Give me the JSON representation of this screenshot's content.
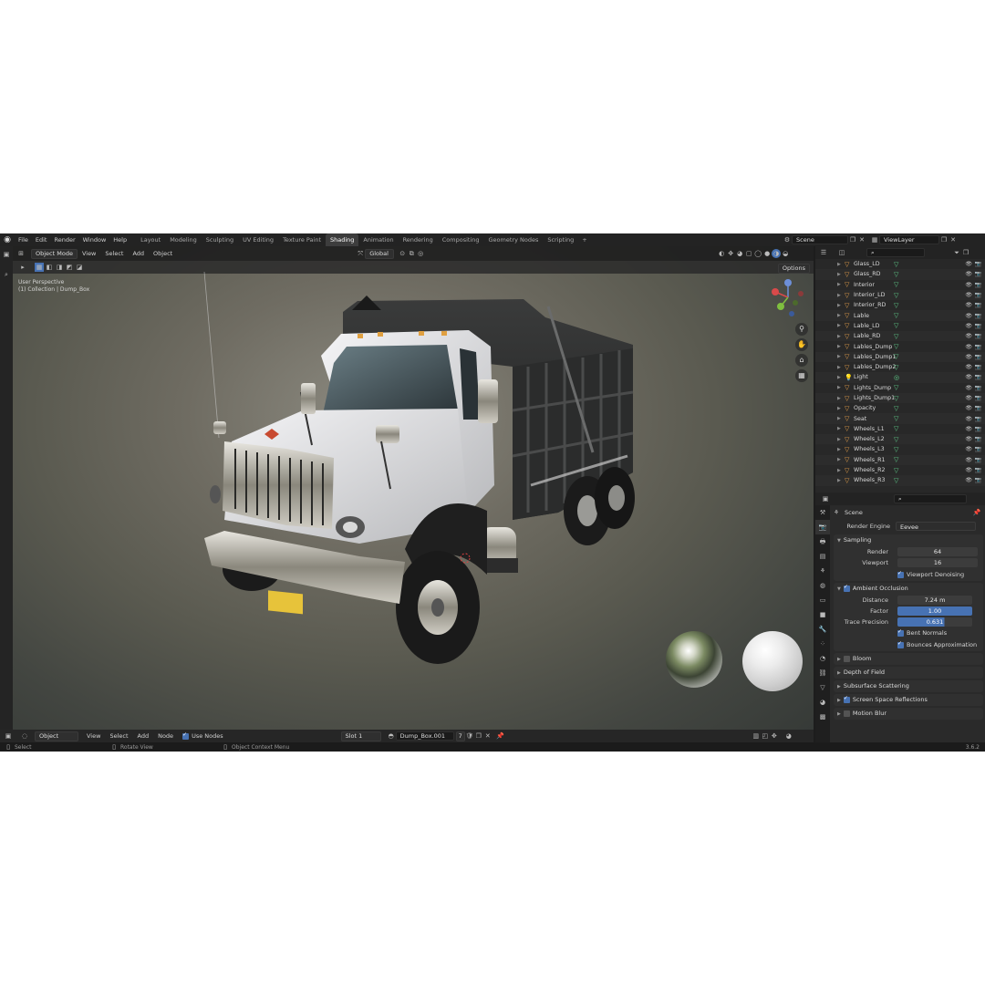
{
  "topbar": {
    "menu": [
      "File",
      "Edit",
      "Render",
      "Window",
      "Help"
    ],
    "workspaces": [
      "Layout",
      "Modeling",
      "Sculpting",
      "UV Editing",
      "Texture Paint",
      "Shading",
      "Animation",
      "Rendering",
      "Compositing",
      "Geometry Nodes",
      "Scripting"
    ],
    "active_workspace": "Shading",
    "add_tab": "+",
    "scene": "Scene",
    "view_layer": "ViewLayer"
  },
  "viewport": {
    "mode": "Object Mode",
    "menu": [
      "View",
      "Select",
      "Add",
      "Object"
    ],
    "orientation": "Global",
    "options": "Options",
    "info_line1": "User Perspective",
    "info_line2": "(1) Collection | Dump_Box"
  },
  "node_editor": {
    "type": "Object",
    "menu": [
      "View",
      "Select",
      "Add",
      "Node"
    ],
    "use_nodes_label": "Use Nodes",
    "slot": "Slot 1",
    "material": "Dump_Box.001",
    "users": "7"
  },
  "outliner": {
    "items": [
      {
        "name": "Glass_LD",
        "type": "mesh"
      },
      {
        "name": "Glass_RD",
        "type": "mesh"
      },
      {
        "name": "Interior",
        "type": "mesh"
      },
      {
        "name": "Interior_LD",
        "type": "mesh"
      },
      {
        "name": "Interior_RD",
        "type": "mesh"
      },
      {
        "name": "Lable",
        "type": "mesh"
      },
      {
        "name": "Lable_LD",
        "type": "mesh"
      },
      {
        "name": "Lable_RD",
        "type": "mesh"
      },
      {
        "name": "Lables_Dump",
        "type": "mesh"
      },
      {
        "name": "Lables_Dump1",
        "type": "mesh"
      },
      {
        "name": "Lables_Dump2",
        "type": "mesh"
      },
      {
        "name": "Light",
        "type": "light"
      },
      {
        "name": "Lights_Dump",
        "type": "mesh"
      },
      {
        "name": "Lights_Dump1",
        "type": "mesh"
      },
      {
        "name": "Opacity",
        "type": "mesh"
      },
      {
        "name": "Seat",
        "type": "mesh"
      },
      {
        "name": "Wheels_L1",
        "type": "mesh"
      },
      {
        "name": "Wheels_L2",
        "type": "mesh"
      },
      {
        "name": "Wheels_L3",
        "type": "mesh"
      },
      {
        "name": "Wheels_R1",
        "type": "mesh"
      },
      {
        "name": "Wheels_R2",
        "type": "mesh"
      },
      {
        "name": "Wheels_R3",
        "type": "mesh"
      }
    ]
  },
  "properties": {
    "context": "Scene",
    "render_engine_label": "Render Engine",
    "render_engine": "Eevee",
    "sampling": {
      "title": "Sampling",
      "render_label": "Render",
      "render": "64",
      "viewport_label": "Viewport",
      "viewport": "16",
      "denoise_label": "Viewport Denoising"
    },
    "ao": {
      "title": "Ambient Occlusion",
      "distance_label": "Distance",
      "distance": "7.24 m",
      "factor_label": "Factor",
      "factor": "1.00",
      "trace_label": "Trace Precision",
      "trace": "0.631",
      "bent_label": "Bent Normals",
      "bounces_label": "Bounces Approximation"
    },
    "panels": [
      "Bloom",
      "Depth of Field",
      "Subsurface Scattering",
      "Screen Space Reflections",
      "Motion Blur"
    ]
  },
  "statusbar": {
    "select": "Select",
    "rotate": "Rotate View",
    "context": "Object Context Menu",
    "version": "3.6.2"
  },
  "colors": {
    "accent": "#4772b3",
    "mesh_icon": "#5fcf8a",
    "object_icon": "#e8a04a",
    "truck_body": "#e8e8ea",
    "dump_box": "#2a2b2b"
  }
}
